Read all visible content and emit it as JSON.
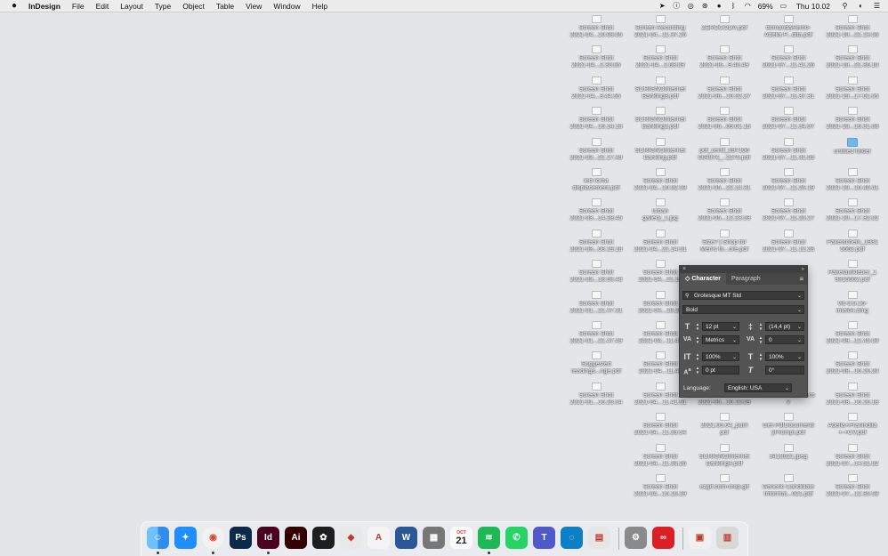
{
  "menubar": {
    "app_name": "InDesign",
    "menus": [
      "File",
      "Edit",
      "Layout",
      "Type",
      "Object",
      "Table",
      "View",
      "Window",
      "Help"
    ],
    "battery": "69%",
    "clock": "Thu 10.02"
  },
  "desktop_icons": [
    {
      "label": "Screen Shot",
      "sub": "2021-04...10.09.05",
      "col": 0,
      "row": 0
    },
    {
      "label": "Screen Recording",
      "sub": "2021-04...11.37.26",
      "col": 1,
      "row": 0
    },
    {
      "label": "ZEROCODA.pdf",
      "sub": "",
      "col": 2,
      "row": 0
    },
    {
      "label": "domandaRemo-",
      "sub": "Adelia P...dita.pdf",
      "col": 3,
      "row": 0
    },
    {
      "label": "Screen Shot",
      "sub": "2021-10...21.13.56",
      "col": 4,
      "row": 0
    },
    {
      "label": "Screen Shot",
      "sub": "2021-04...2.30.05",
      "col": 0,
      "row": 1
    },
    {
      "label": "Screen Shot",
      "sub": "2021-04...2.08.03",
      "col": 1,
      "row": 1
    },
    {
      "label": "Screen Shot",
      "sub": "2021-06...9.40.49",
      "col": 2,
      "row": 1
    },
    {
      "label": "Screen Shot",
      "sub": "2021-07...11.41.26",
      "col": 3,
      "row": 1
    },
    {
      "label": "Screen Shot",
      "sub": "2021-10...21.36.10",
      "col": 4,
      "row": 1
    },
    {
      "label": "Screen Shot",
      "sub": "2021-04...3.44.55",
      "col": 0,
      "row": 2
    },
    {
      "label": "SCRIGNOInternet",
      "sub": "Banking3.pdf",
      "col": 1,
      "row": 2
    },
    {
      "label": "Screen Shot",
      "sub": "2021-06...10.52.27",
      "col": 2,
      "row": 2
    },
    {
      "label": "Screen Shot",
      "sub": "2021-07...11.37.31",
      "col": 3,
      "row": 2
    },
    {
      "label": "Screen Shot",
      "sub": "2021-10...17.01.05",
      "col": 4,
      "row": 2
    },
    {
      "label": "Screen Shot",
      "sub": "2021-04...16.14.13",
      "col": 0,
      "row": 3
    },
    {
      "label": "SCRIGNOInternet",
      "sub": "Banking2.pdf",
      "col": 1,
      "row": 3
    },
    {
      "label": "Screen Shot",
      "sub": "2021-06...09.01.15",
      "col": 2,
      "row": 3
    },
    {
      "label": "Screen Shot",
      "sub": "2021-07...11.34.07",
      "col": 3,
      "row": 3
    },
    {
      "label": "Screen Shot",
      "sub": "2021-10...16.31.08",
      "col": 4,
      "row": 3
    },
    {
      "label": "Screen Shot",
      "sub": "2021-03...21.17.49",
      "col": 0,
      "row": 4
    },
    {
      "label": "SCRIGNOInternet",
      "sub": "Banking.pdf",
      "col": 1,
      "row": 4
    },
    {
      "label": "pdf_certif_097106",
      "sub": "004874_..2275.pdf",
      "col": 2,
      "row": 4
    },
    {
      "label": "Screen Shot",
      "sub": "2021-07...11.31.03",
      "col": 3,
      "row": 4
    },
    {
      "label": "untitled folder",
      "sub": "",
      "col": 4,
      "row": 4,
      "folder": true
    },
    {
      "label": "ied roma",
      "sub": "displacement.pdf",
      "col": 0,
      "row": 5
    },
    {
      "label": "Screen Shot",
      "sub": "2021-04...10.52.53",
      "col": 1,
      "row": 5
    },
    {
      "label": "Screen Shot",
      "sub": "2021-05...22.14.31",
      "col": 2,
      "row": 5
    },
    {
      "label": "Screen Shot",
      "sub": "2021-07...11.26.19",
      "col": 3,
      "row": 5
    },
    {
      "label": "Screen Shot",
      "sub": "2021-10...10.40.41",
      "col": 4,
      "row": 5
    },
    {
      "label": "Screen Shot",
      "sub": "2021-03...14.28.45",
      "col": 0,
      "row": 6
    },
    {
      "label": "urban",
      "sub": "gallery_1.jpg",
      "col": 1,
      "row": 6
    },
    {
      "label": "Screen Shot",
      "sub": "2021-05...12.23.53",
      "col": 2,
      "row": 6
    },
    {
      "label": "Screen Shot",
      "sub": "2021-07...11.20.27",
      "col": 3,
      "row": 6
    },
    {
      "label": "Screen Shot",
      "sub": "2021-10...17.32.02",
      "col": 4,
      "row": 6
    },
    {
      "label": "Screen Shot",
      "sub": "2021-03...08.19.18",
      "col": 0,
      "row": 7
    },
    {
      "label": "Screen Shot",
      "sub": "2021-04...21.14.51",
      "col": 1,
      "row": 7
    },
    {
      "label": "Size? | Shop for",
      "sub": "Men's fo...ore.pdf",
      "col": 2,
      "row": 7
    },
    {
      "label": "Screen Shot",
      "sub": "2021-07...11.12.28",
      "col": 3,
      "row": 7
    },
    {
      "label": "Paketschein_1931",
      "sub": "5662.pdf",
      "col": 4,
      "row": 7
    },
    {
      "label": "Screen Shot",
      "sub": "2021-03...18.53.48",
      "col": 0,
      "row": 8
    },
    {
      "label": "Screen Shot",
      "sub": "2021-04...21.14",
      "col": 1,
      "row": 8
    },
    {
      "label": "Paketaufkleber_1",
      "sub": "9315662.pdf",
      "col": 4,
      "row": 8
    },
    {
      "label": "Screen Shot",
      "sub": "2021-01...21.47.31",
      "col": 0,
      "row": 9
    },
    {
      "label": "Screen Shot",
      "sub": "2021-04...18.28",
      "col": 1,
      "row": 9
    },
    {
      "label": "vlc-3.0.16-",
      "sub": "intel64.dmg",
      "col": 4,
      "row": 9
    },
    {
      "label": "Screen Shot",
      "sub": "2021-01...21.47.49",
      "col": 0,
      "row": 10
    },
    {
      "label": "Screen Shot",
      "sub": "2021-04...11.43",
      "col": 1,
      "row": 10
    },
    {
      "label": "Screen Shot",
      "sub": "2021-09...12.45.00",
      "col": 4,
      "row": 10
    },
    {
      "label": "Suggested",
      "sub": "readings...nge.pdf",
      "col": 0,
      "row": 11
    },
    {
      "label": "Screen Shot",
      "sub": "2021-04...11.43",
      "col": 1,
      "row": 11
    },
    {
      "label": "Screen Shot",
      "sub": "2021-08...16.16.20",
      "col": 4,
      "row": 11
    },
    {
      "label": "Screen Shot",
      "sub": "2021-01...16.25.54",
      "col": 0,
      "row": 12
    },
    {
      "label": "Screen Shot",
      "sub": "2021-04...11.41.51",
      "col": 1,
      "row": 12
    },
    {
      "label": "Screen Shot",
      "sub": "2021-05...10.10.09",
      "col": 2,
      "row": 12
    },
    {
      "label": "movimentiConto.cs",
      "sub": "v",
      "col": 3,
      "row": 12
    },
    {
      "label": "Screen Shot",
      "sub": "2021-08...16.16.18",
      "col": 4,
      "row": 12
    },
    {
      "label": "Screen Shot",
      "sub": "2021-04...11.39.54",
      "col": 1,
      "row": 13
    },
    {
      "label": "2021.05.04_putri",
      "sub": "pdf",
      "col": 2,
      "row": 13
    },
    {
      "label": "Get-PdfDocumenti",
      "sub": "yPrompt.pdf",
      "col": 3,
      "row": 13
    },
    {
      "label": "Adelia+Pranindita",
      "sub": "+-+CV.pdf",
      "col": 4,
      "row": 13
    },
    {
      "label": "Screen Shot",
      "sub": "2021-04...11.38.26",
      "col": 1,
      "row": 14
    },
    {
      "label": "SCRIGNOInternet",
      "sub": "Banking4.pdf",
      "col": 2,
      "row": 14
    },
    {
      "label": "3413621.jpeg",
      "sub": "",
      "col": 3,
      "row": 14
    },
    {
      "label": "Screen Shot",
      "sub": "2021-07...14.51.02",
      "col": 4,
      "row": 14
    },
    {
      "label": "Screen Shot",
      "sub": "2021-04...15.15.29",
      "col": 1,
      "row": 15
    },
    {
      "label": "ezgif.com-crop.gif",
      "sub": "",
      "col": 2,
      "row": 15
    },
    {
      "label": "Generic Candidate",
      "sub": "Informat...021.pdf",
      "col": 3,
      "row": 15
    },
    {
      "label": "Screen Shot",
      "sub": "2021-07...12.35.58",
      "col": 4,
      "row": 15
    }
  ],
  "character_panel": {
    "tab_character": "Character",
    "tab_paragraph": "Paragraph",
    "font_family": "Grotesque MT Std",
    "font_style": "Bold",
    "font_size": "12 pt",
    "leading": "(14,4 pt)",
    "kerning": "Metrics",
    "tracking": "0",
    "vertical_scale": "100%",
    "horizontal_scale": "100%",
    "baseline_shift": "0 pt",
    "skew": "0°",
    "language_label": "Language:",
    "language_value": "English: USA"
  },
  "dock": {
    "apps": [
      {
        "name": "finder",
        "glyph": "☺",
        "bg": "#2f8df0",
        "running": true
      },
      {
        "name": "safari",
        "glyph": "✦",
        "bg": "#1f8fff",
        "running": false
      },
      {
        "name": "chrome",
        "glyph": "◉",
        "bg": "#f2f2f2",
        "running": true
      },
      {
        "name": "photoshop",
        "glyph": "Ps",
        "bg": "#0b2a4a",
        "running": false
      },
      {
        "name": "indesign",
        "glyph": "Id",
        "bg": "#49021f",
        "running": true
      },
      {
        "name": "illustrator",
        "glyph": "Ai",
        "bg": "#330000",
        "running": false
      },
      {
        "name": "figma",
        "glyph": "✿",
        "bg": "#1e1e1e",
        "running": false
      },
      {
        "name": "sketchup",
        "glyph": "◆",
        "bg": "#e8e8e8",
        "running": false
      },
      {
        "name": "acrobat",
        "glyph": "A",
        "bg": "#f4f4f4",
        "running": false
      },
      {
        "name": "word",
        "glyph": "W",
        "bg": "#2b5797",
        "running": false
      },
      {
        "name": "calculator",
        "glyph": "▦",
        "bg": "#777",
        "running": false
      },
      {
        "name": "calendar",
        "glyph": "21",
        "bg": "#fafafa",
        "running": false
      },
      {
        "name": "spotify",
        "glyph": "≋",
        "bg": "#1db954",
        "running": true
      },
      {
        "name": "whatsapp",
        "glyph": "✆",
        "bg": "#25d366",
        "running": false
      },
      {
        "name": "teams",
        "glyph": "T",
        "bg": "#5059c9",
        "running": false
      },
      {
        "name": "edge",
        "glyph": "◌",
        "bg": "#0d7fc4",
        "running": false
      },
      {
        "name": "preview",
        "glyph": "▤",
        "bg": "#e6e6e6",
        "running": false
      },
      {
        "name": "system-preferences",
        "glyph": "⚙",
        "bg": "#8a8a8a",
        "running": false
      },
      {
        "name": "creative-cloud",
        "glyph": "∞",
        "bg": "#da1f26",
        "running": false
      },
      {
        "name": "downloads-stack",
        "glyph": "▣",
        "bg": "#f0f0f0",
        "running": false
      },
      {
        "name": "trash",
        "glyph": "▥",
        "bg": "#d8d8d8",
        "running": false
      }
    ],
    "calendar_month": "OCT",
    "calendar_day": "21"
  }
}
